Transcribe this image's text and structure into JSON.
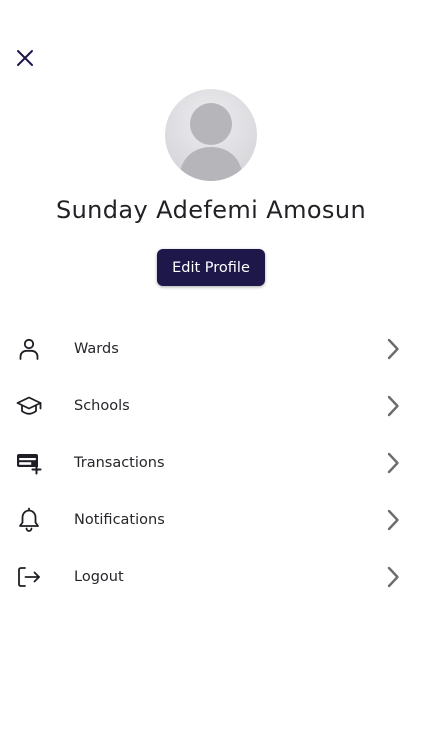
{
  "header": {
    "close_icon": "close-icon"
  },
  "profile": {
    "name": "Sunday Adefemi Amosun",
    "edit_label": "Edit Profile",
    "avatar_icon": "default-avatar-icon"
  },
  "menu": {
    "items": [
      {
        "label": "Wards",
        "icon": "person-icon"
      },
      {
        "label": "Schools",
        "icon": "graduation-cap-icon"
      },
      {
        "label": "Transactions",
        "icon": "credit-card-plus-icon"
      },
      {
        "label": "Notifications",
        "icon": "bell-icon"
      },
      {
        "label": "Logout",
        "icon": "logout-icon"
      }
    ]
  },
  "colors": {
    "primary": "#1e174a",
    "text": "#222226",
    "chevron": "#6b6b70",
    "icon": "#1e1e24"
  }
}
